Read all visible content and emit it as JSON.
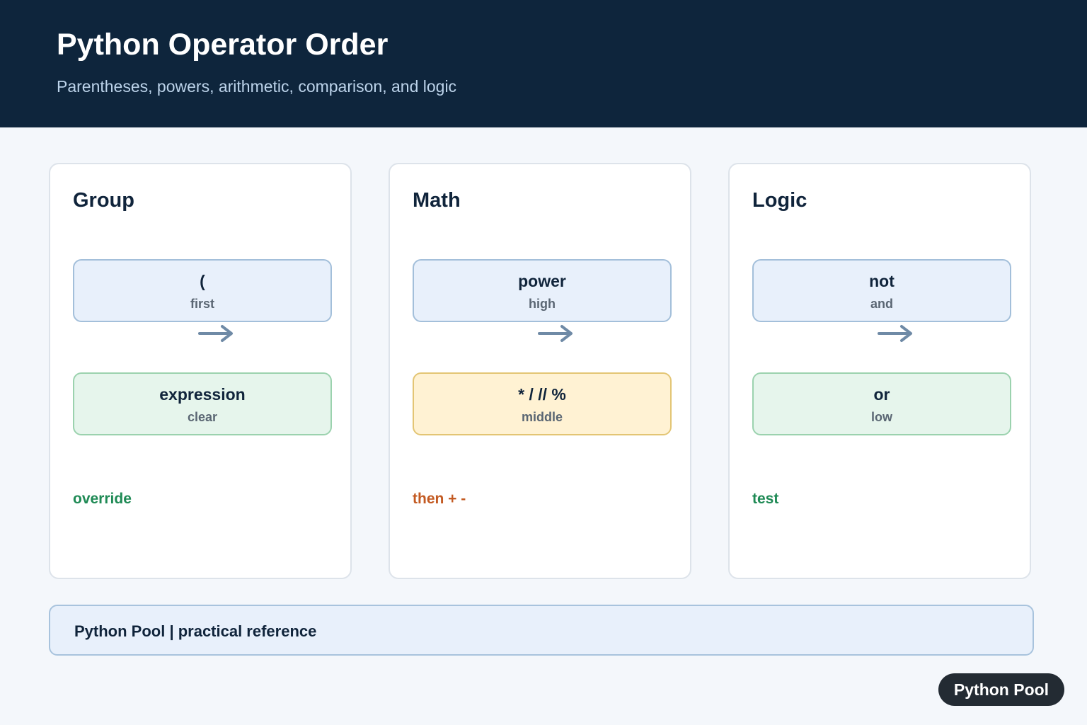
{
  "header": {
    "title": "Python Operator Order",
    "subtitle": "Parentheses, powers, arithmetic, comparison, and logic"
  },
  "cards": [
    {
      "title": "Group",
      "top": {
        "main": "(",
        "sub": "first"
      },
      "bottom": {
        "main": "expression",
        "sub": "clear"
      },
      "note": "override"
    },
    {
      "title": "Math",
      "top": {
        "main": "power",
        "sub": "high"
      },
      "bottom": {
        "main": "* / // %",
        "sub": "middle"
      },
      "note": "then + -"
    },
    {
      "title": "Logic",
      "top": {
        "main": "not",
        "sub": "and"
      },
      "bottom": {
        "main": "or",
        "sub": "low"
      },
      "note": "test"
    }
  ],
  "footer": {
    "text": "Python Pool | practical reference"
  },
  "badge": {
    "label": "Python Pool"
  },
  "colors": {
    "header_bg": "#0e253c",
    "box_blue": "#e8f0fb",
    "box_green": "#e6f5ec",
    "box_yellow": "#fff2d3",
    "note_green": "#1f8a55",
    "note_orange": "#c35a22",
    "arrow": "#6f8aa6"
  },
  "icons": {
    "arrow": "arrow-right-icon"
  }
}
